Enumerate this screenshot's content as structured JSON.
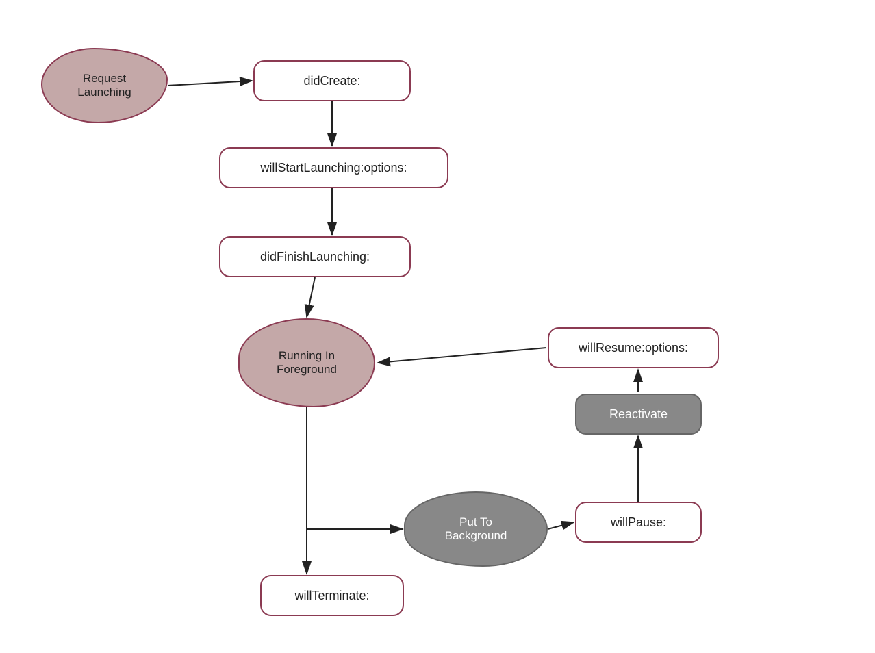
{
  "nodes": {
    "request_launching": {
      "label": "Request\nLaunching"
    },
    "did_create": {
      "label": "didCreate:"
    },
    "will_start_launching": {
      "label": "willStartLaunching:options:"
    },
    "did_finish_launching": {
      "label": "didFinishLaunching:"
    },
    "running_in_foreground": {
      "label": "Running In\nForeground"
    },
    "will_resume": {
      "label": "willResume:options:"
    },
    "reactivate": {
      "label": "Reactivate"
    },
    "put_to_background": {
      "label": "Put To\nBackground"
    },
    "will_pause": {
      "label": "willPause:"
    },
    "will_terminate": {
      "label": "willTerminate:"
    }
  }
}
